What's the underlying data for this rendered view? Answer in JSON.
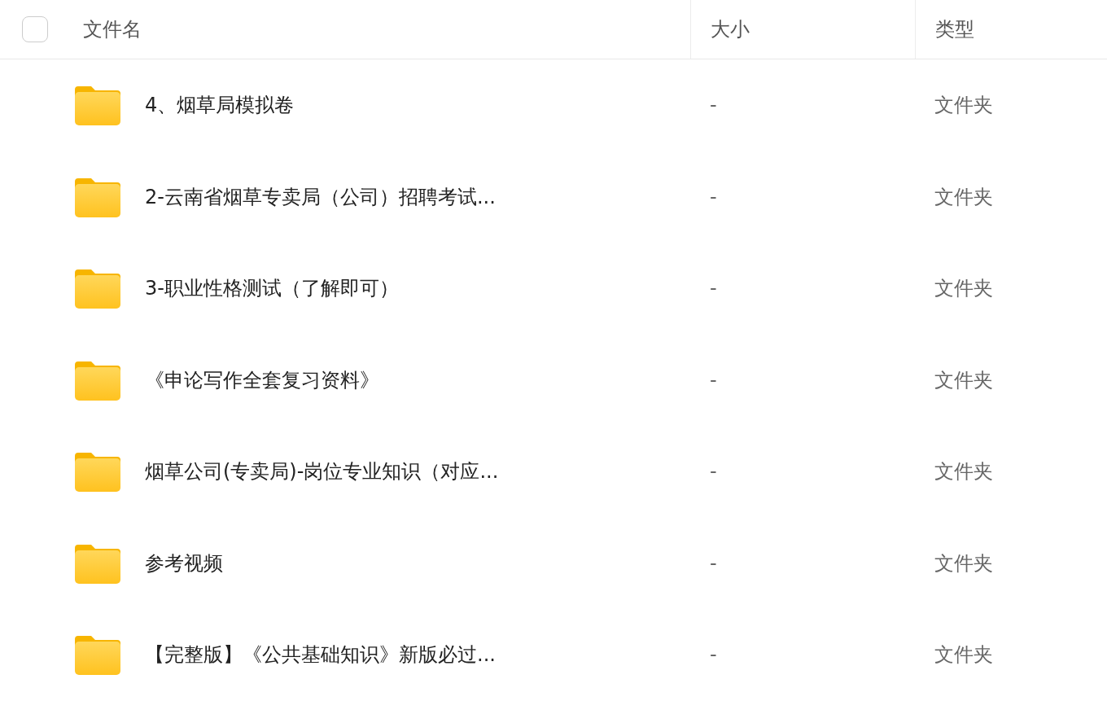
{
  "header": {
    "select_all": {
      "checked": false
    },
    "columns": [
      "文件名",
      "大小",
      "类型"
    ]
  },
  "rows": [
    {
      "name": "4、烟草局模拟卷",
      "size": "-",
      "type": "文件夹"
    },
    {
      "name": "2-云南省烟草专卖局（公司）招聘考试...",
      "size": "-",
      "type": "文件夹"
    },
    {
      "name": "3-职业性格测试（了解即可）",
      "size": "-",
      "type": "文件夹"
    },
    {
      "name": "《申论写作全套复习资料》",
      "size": "-",
      "type": "文件夹"
    },
    {
      "name": "烟草公司(专卖局)-岗位专业知识（对应...",
      "size": "-",
      "type": "文件夹"
    },
    {
      "name": "参考视频",
      "size": "-",
      "type": "文件夹"
    },
    {
      "name": "【完整版】《公共基础知识》新版必过...",
      "size": "-",
      "type": "文件夹"
    }
  ]
}
